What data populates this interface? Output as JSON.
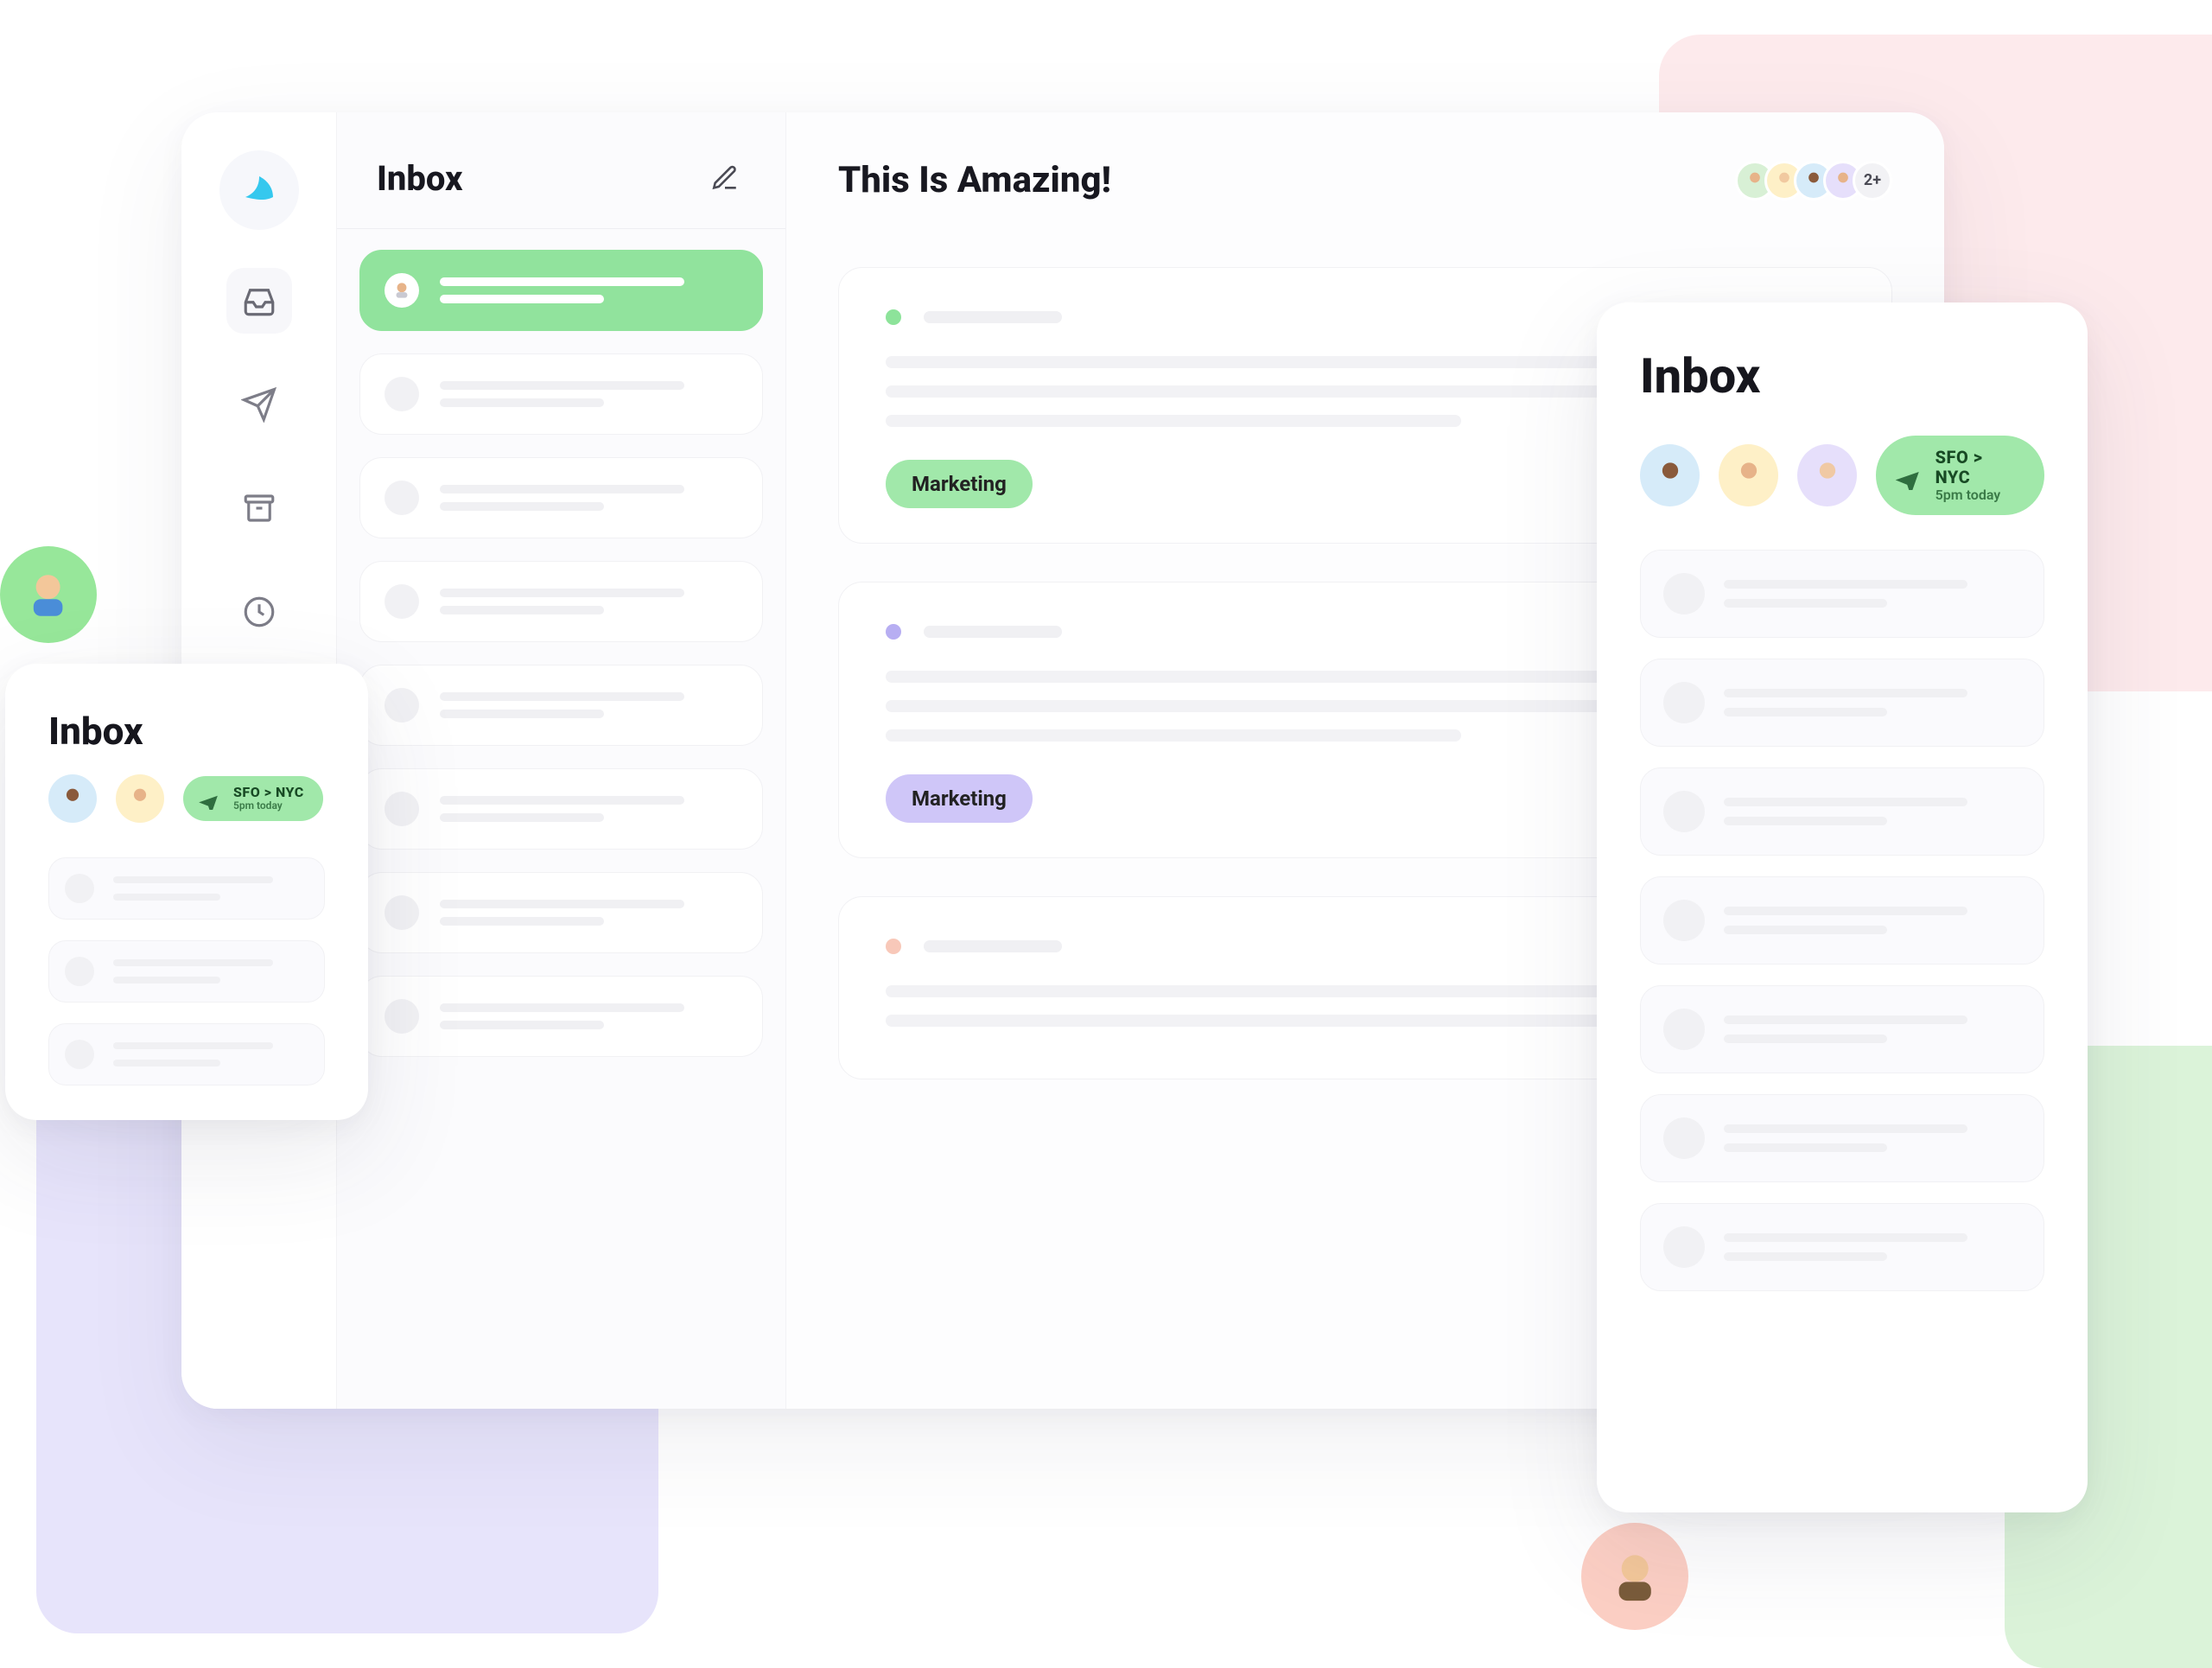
{
  "app": {
    "nav": {
      "icons": [
        "inbox",
        "send",
        "archive",
        "history"
      ]
    },
    "inbox": {
      "title": "Inbox"
    },
    "reader": {
      "title": "This Is Amazing!",
      "participants_overflow": "2+",
      "cards": [
        {
          "tag": "Marketing",
          "tag_color": "green",
          "dot": "green"
        },
        {
          "tag": "Marketing",
          "tag_color": "purple",
          "dot": "purple"
        },
        {
          "tag": "",
          "tag_color": "",
          "dot": "peach"
        }
      ]
    }
  },
  "floating_right": {
    "title": "Inbox",
    "flight": {
      "route": "SFO > NYC",
      "sub": "5pm today"
    }
  },
  "floating_left": {
    "title": "Inbox",
    "flight": {
      "route": "SFO > NYC",
      "sub": "5pm today"
    }
  }
}
